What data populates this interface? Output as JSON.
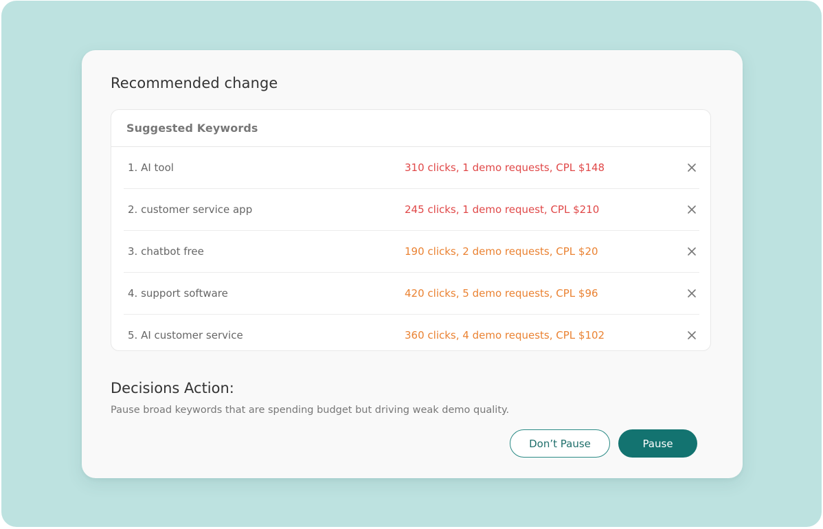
{
  "card": {
    "title": "Recommended change"
  },
  "keywords": {
    "header": "Suggested Keywords",
    "items": [
      {
        "name": "1. AI tool",
        "stats": "310 clicks, 1 demo requests, CPL $148",
        "stat_color": "#e04848"
      },
      {
        "name": "2. customer service app",
        "stats": "245 clicks, 1 demo request, CPL $210",
        "stat_color": "#e04848"
      },
      {
        "name": "3. chatbot free",
        "stats": "190 clicks, 2 demo requests, CPL $20",
        "stat_color": "#ea8232"
      },
      {
        "name": "4. support software",
        "stats": "420 clicks, 5 demo requests, CPL $96",
        "stat_color": "#ea8232"
      },
      {
        "name": "5. AI customer service",
        "stats": "360 clicks, 4 demo requests, CPL $102",
        "stat_color": "#ea8232"
      }
    ],
    "remove_icon": "close-icon"
  },
  "decisions": {
    "title": "Decisions Action:",
    "description": "Pause broad keywords that are spending budget but driving weak demo quality."
  },
  "actions": {
    "dont_pause_label": "Don’t Pause",
    "pause_label": "Pause"
  },
  "colors": {
    "backdrop": "#bde2e0",
    "primary": "#137370",
    "high_cpl": "#e04848",
    "mid_cpl": "#ea8232"
  }
}
